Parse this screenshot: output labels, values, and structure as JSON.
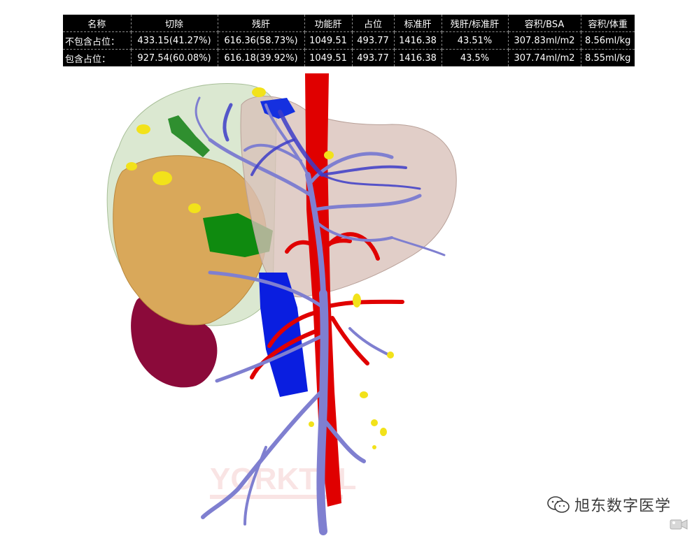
{
  "table": {
    "headers": [
      "名称",
      "切除",
      "残肝",
      "功能肝",
      "占位",
      "标准肝",
      "残肝/标准肝",
      "容积/BSA",
      "容积/体重"
    ],
    "rows": [
      [
        "不包含占位：",
        "433.15(41.27%)",
        "616.36(58.73%)",
        "1049.51",
        "493.77",
        "1416.38",
        "43.51%",
        "307.83ml/m2",
        "8.56ml/kg"
      ],
      [
        "包含占位：",
        "927.54(60.08%)",
        "616.18(39.92%)",
        "1049.51",
        "493.77",
        "1416.38",
        "43.5%",
        "307.74ml/m2",
        "8.55ml/kg"
      ]
    ]
  },
  "watermark": {
    "text": "旭东数字医学",
    "icon": "wechat-icon"
  },
  "colors": {
    "table_bg": "#000000",
    "table_text": "#ffffff",
    "hepatic_artery": "#e00000",
    "portal_vein": "#7f7fd0",
    "vena_cava": "#0a1ee0",
    "tumor": "#d9a85a",
    "gallbladder": "#8b0a3a",
    "liver_transparent": "#d8c8c0"
  }
}
